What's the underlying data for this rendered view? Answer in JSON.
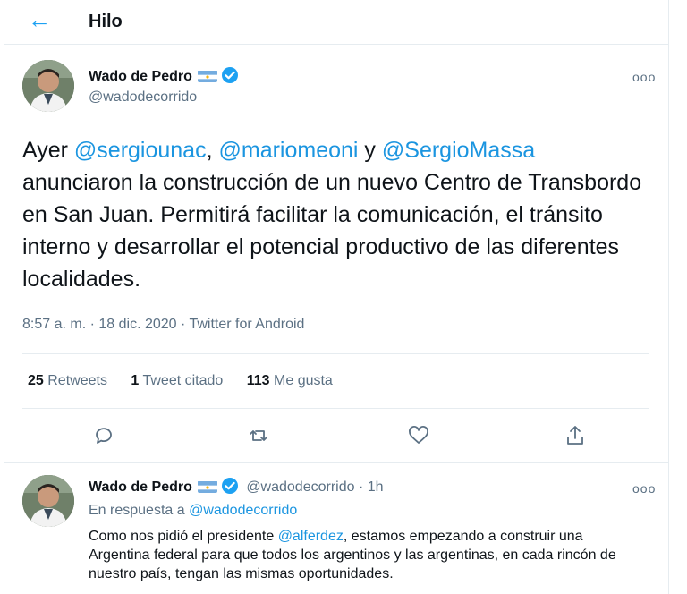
{
  "header": {
    "title": "Hilo"
  },
  "main_tweet": {
    "author_name": "Wado de Pedro",
    "handle": "@wadodecorrido",
    "text_parts": {
      "p1": "Ayer ",
      "m1": "@sergiounac",
      "p2": ", ",
      "m2": "@mariomeoni",
      "p3": " y ",
      "m3": "@SergioMassa",
      "p4": " anunciaron la construcción de un nuevo Centro de Transbordo en San Juan. Permitirá facilitar la comunicación, el tránsito interno y desarrollar el potencial productivo de las diferentes localidades."
    },
    "meta": "8:57 a. m. · 18 dic. 2020 · Twitter for Android",
    "stats": {
      "retweets_count": "25",
      "retweets_label": "Retweets",
      "quotes_count": "1",
      "quotes_label": "Tweet citado",
      "likes_count": "113",
      "likes_label": "Me gusta"
    },
    "actions": [
      "reply-icon",
      "retweet-icon",
      "like-icon",
      "share-icon"
    ]
  },
  "reply_tweet": {
    "author_name": "Wado de Pedro",
    "handle_time": "@wadodecorrido · 1h",
    "in_reply_prefix": "En respuesta a ",
    "in_reply_handle": "@wadodecorrido",
    "text_parts": {
      "p1": "Como nos pidió el presidente ",
      "m1": "@alferdez",
      "p2": ", estamos empezando a construir una Argentina federal para que todos los argentinos y las argentinas, en cada rincón de nuestro país, tengan las mismas oportunidades."
    }
  },
  "more_glyph": "ooo",
  "colors": {
    "accent": "#1da1f2",
    "mention": "#1b95e0",
    "secondary": "#5b7083",
    "border": "#e6ecf0"
  }
}
